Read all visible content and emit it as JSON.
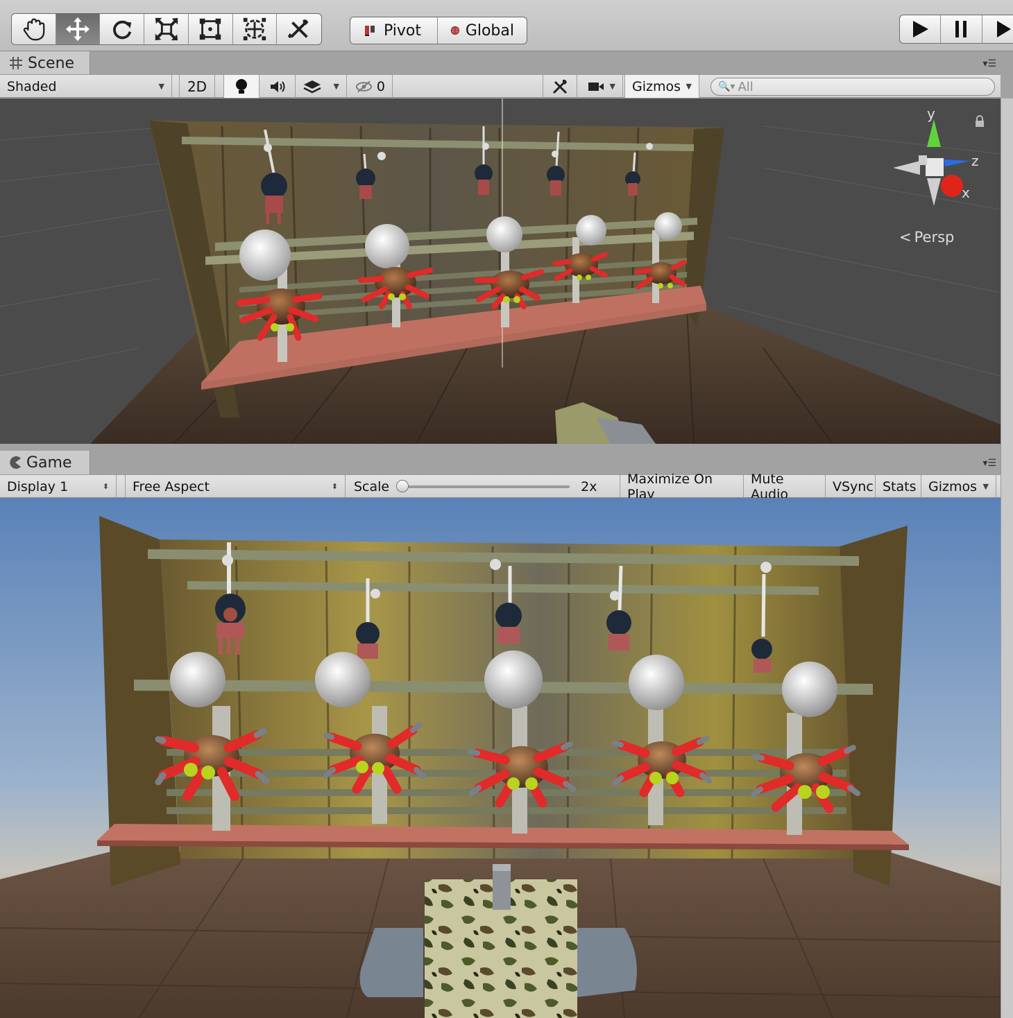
{
  "toolbar": {
    "tools": [
      {
        "name": "hand-tool",
        "icon": "hand-icon",
        "active": false
      },
      {
        "name": "move-tool",
        "icon": "move-icon",
        "active": true
      },
      {
        "name": "rotate-tool",
        "icon": "rotate-icon",
        "active": false
      },
      {
        "name": "scale-tool",
        "icon": "scale-icon",
        "active": false
      },
      {
        "name": "rect-tool",
        "icon": "rect-icon",
        "active": false
      },
      {
        "name": "transform-tool",
        "icon": "transform-icon",
        "active": false
      },
      {
        "name": "custom-tool",
        "icon": "custom-tool-icon",
        "active": false
      }
    ],
    "pivot_label": "Pivot",
    "global_label": "Global"
  },
  "scene": {
    "tab_label": "Scene",
    "shading_mode": "Shaded",
    "mode_2d_label": "2D",
    "hidden_count": "0",
    "gizmos_label": "Gizmos",
    "search_placeholder": "All",
    "projection_label": "Persp",
    "axis_labels": {
      "y": "y",
      "z": "z",
      "x": "x"
    }
  },
  "game": {
    "tab_label": "Game",
    "display_label": "Display 1",
    "aspect_label": "Free Aspect",
    "scale_label": "Scale",
    "scale_value": "2x",
    "maximize_label": "Maximize On Play",
    "mute_label": "Mute Audio",
    "vsync_label": "VSync",
    "stats_label": "Stats",
    "gizmos_label": "Gizmos"
  },
  "colors": {
    "accent_active_tool": "#6a6a6a",
    "axis_y": "#5fd43a",
    "axis_z": "#2a6ee6",
    "axis_x": "#e0241a",
    "sky": "#5a82b8"
  }
}
